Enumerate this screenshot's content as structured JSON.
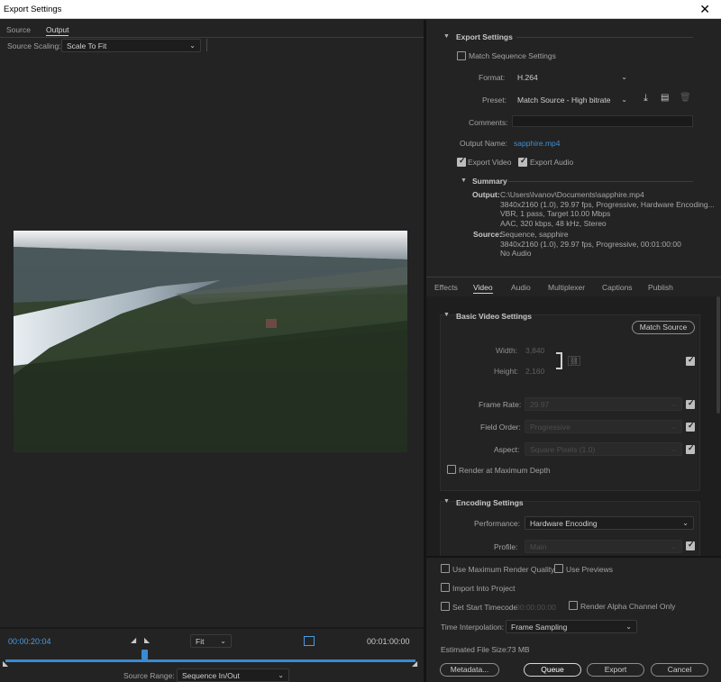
{
  "window": {
    "title": "Export Settings",
    "close": "✕"
  },
  "left": {
    "tabs": [
      "Source",
      "Output"
    ],
    "scaling_label": "Source Scaling:",
    "scaling_value": "Scale To Fit",
    "timecode_current": "00:00:20:04",
    "timecode_end": "00:01:00:00",
    "zoom_value": "Fit",
    "playhead_fraction": 0.34,
    "source_range_label": "Source Range:",
    "source_range_value": "Sequence In/Out"
  },
  "export": {
    "section_title": "Export Settings",
    "match_sequence": "Match Sequence Settings",
    "format_label": "Format:",
    "format_value": "H.264",
    "preset_label": "Preset:",
    "preset_value": "Match Source - High bitrate",
    "comments_label": "Comments:",
    "output_name_label": "Output Name:",
    "output_name_value": "sapphire.mp4",
    "export_video": "Export Video",
    "export_audio": "Export Audio",
    "summary_title": "Summary",
    "output_label": "Output:",
    "output_lines": [
      "C:\\Users\\Ivanov\\Documents\\sapphire.mp4",
      "3840x2160 (1.0), 29.97 fps, Progressive, Hardware Encoding...",
      "VBR, 1 pass, Target 10.00 Mbps",
      "AAC, 320 kbps, 48 kHz, Stereo"
    ],
    "source_label": "Source:",
    "source_lines": [
      "Sequence, sapphire",
      "3840x2160 (1.0), 29.97 fps, Progressive, 00:01:00:00",
      "No Audio"
    ]
  },
  "tabs": [
    "Effects",
    "Video",
    "Audio",
    "Multiplexer",
    "Captions",
    "Publish"
  ],
  "video": {
    "basic_title": "Basic Video Settings",
    "match_source_btn": "Match Source",
    "width_label": "Width:",
    "width_value": "3,840",
    "height_label": "Height:",
    "height_value": "2,160",
    "frame_rate_label": "Frame Rate:",
    "frame_rate_value": "29.97",
    "field_order_label": "Field Order:",
    "field_order_value": "Progressive",
    "aspect_label": "Aspect:",
    "aspect_value": "Square Pixels (1.0)",
    "render_max_depth": "Render at Maximum Depth",
    "encoding_title": "Encoding Settings",
    "performance_label": "Performance:",
    "performance_value": "Hardware Encoding",
    "profile_label": "Profile:",
    "profile_value": "Main"
  },
  "bottom": {
    "max_render_quality": "Use Maximum Render Quality",
    "use_previews": "Use Previews",
    "import_into_project": "Import Into Project",
    "set_start_timecode": "Set Start Timecode",
    "start_timecode_value": "00:00:00:00",
    "render_alpha": "Render Alpha Channel Only",
    "time_interp_label": "Time Interpolation:",
    "time_interp_value": "Frame Sampling",
    "file_size_label": "Estimated File Size:",
    "file_size_value": "73 MB",
    "metadata_btn": "Metadata...",
    "queue_btn": "Queue",
    "export_btn": "Export",
    "cancel_btn": "Cancel"
  }
}
